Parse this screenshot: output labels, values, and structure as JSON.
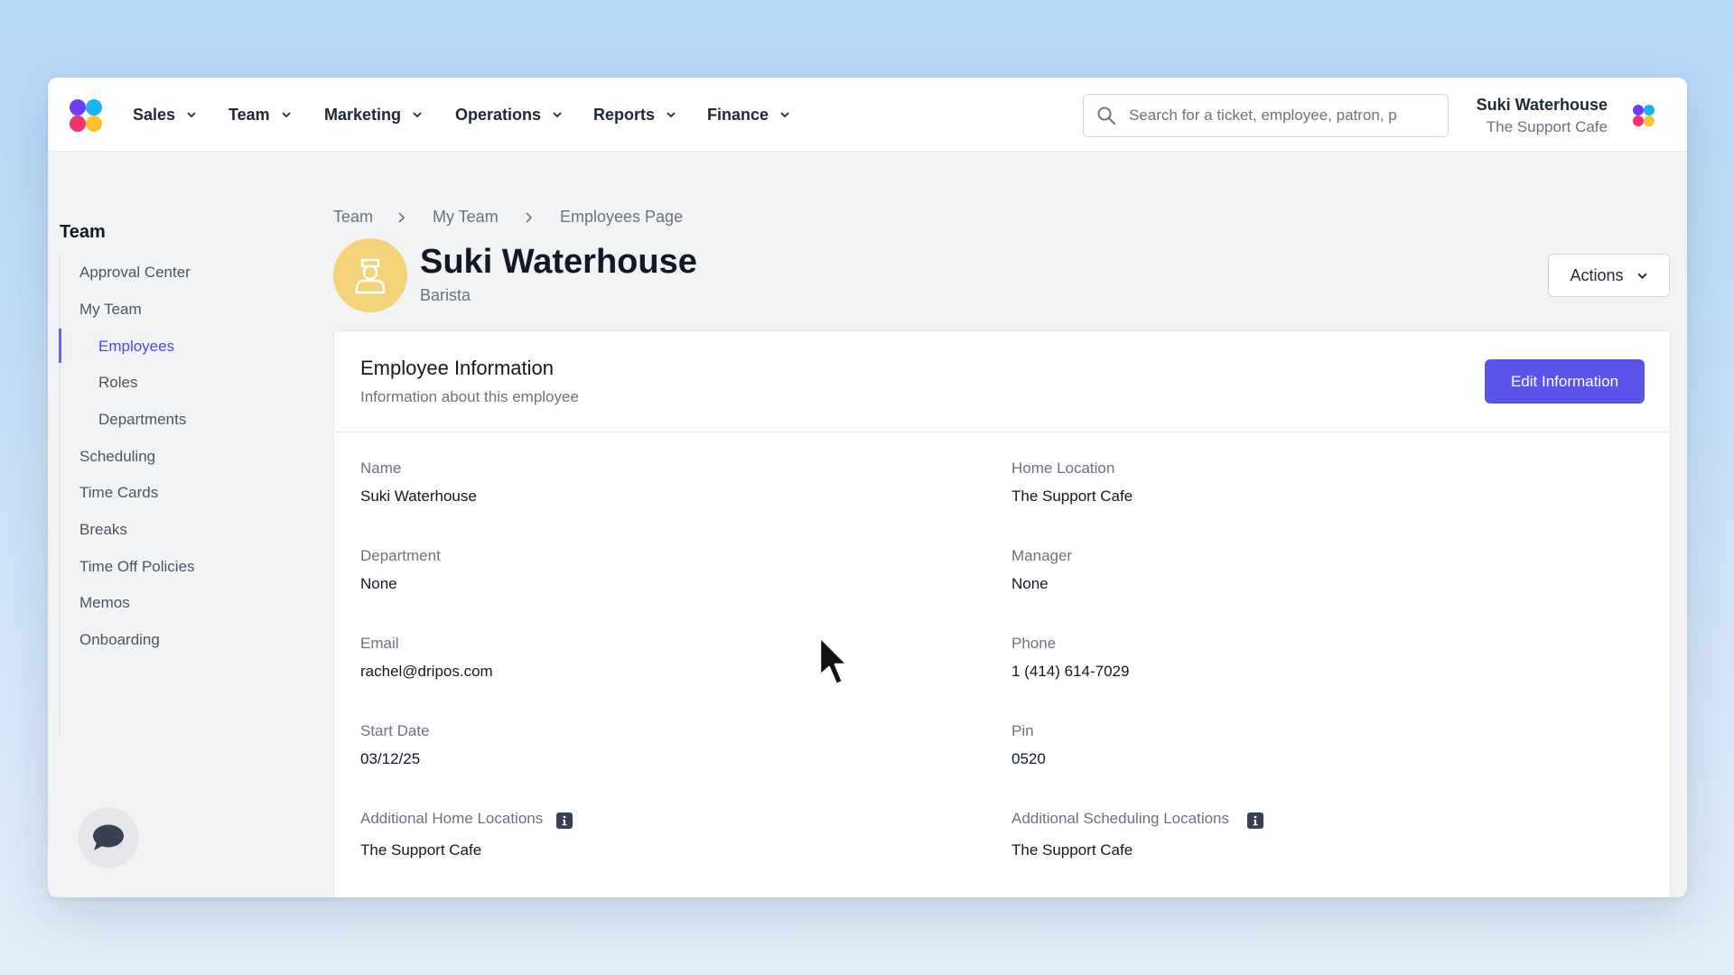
{
  "nav": {
    "items": [
      {
        "label": "Sales"
      },
      {
        "label": "Team"
      },
      {
        "label": "Marketing"
      },
      {
        "label": "Operations"
      },
      {
        "label": "Reports"
      },
      {
        "label": "Finance"
      }
    ],
    "search_placeholder": "Search for a ticket, employee, patron, p",
    "user_name": "Suki Waterhouse",
    "user_location": "The Support Cafe"
  },
  "sidebar": {
    "title": "Team",
    "items": [
      {
        "label": "Approval Center"
      },
      {
        "label": "My Team"
      },
      {
        "label": "Employees"
      },
      {
        "label": "Roles"
      },
      {
        "label": "Departments"
      },
      {
        "label": "Scheduling"
      },
      {
        "label": "Time Cards"
      },
      {
        "label": "Breaks"
      },
      {
        "label": "Time Off Policies"
      },
      {
        "label": "Memos"
      },
      {
        "label": "Onboarding"
      }
    ]
  },
  "breadcrumb": [
    "Team",
    "My Team",
    "Employees Page"
  ],
  "employee": {
    "name": "Suki Waterhouse",
    "role": "Barista"
  },
  "actions_label": "Actions",
  "card": {
    "title": "Employee Information",
    "subtitle": "Information about this employee",
    "edit_label": "Edit Information",
    "fields": [
      {
        "label": "Name",
        "value": "Suki Waterhouse"
      },
      {
        "label": "Home Location",
        "value": "The Support Cafe"
      },
      {
        "label": "Department",
        "value": "None"
      },
      {
        "label": "Manager",
        "value": "None"
      },
      {
        "label": "Email",
        "value": "rachel@dripos.com"
      },
      {
        "label": "Phone",
        "value": "1 (414) 614-7029"
      },
      {
        "label": "Start Date",
        "value": "03/12/25"
      },
      {
        "label": "Pin",
        "value": "0520"
      },
      {
        "label": "Additional Home Locations",
        "value": "The Support Cafe"
      },
      {
        "label": "Additional Scheduling Locations",
        "value": "The Support Cafe"
      }
    ]
  },
  "colors": {
    "accent": "#5b54e8",
    "avatar_bg": "#f3d27a"
  }
}
